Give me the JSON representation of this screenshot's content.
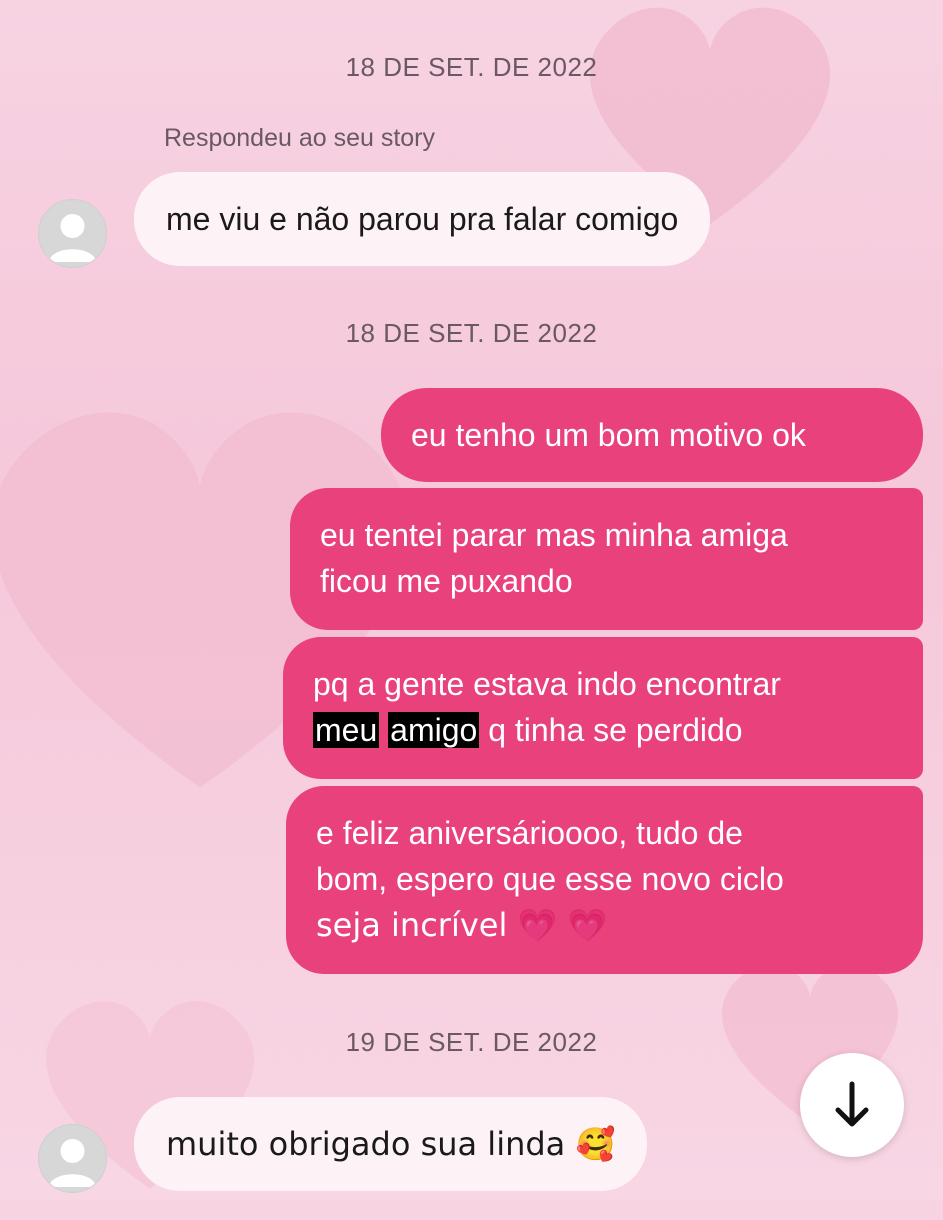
{
  "conversation": {
    "dates": [
      "18 DE SET. DE 2022",
      "18 DE SET. DE 2022",
      "19 DE SET. DE 2022"
    ],
    "story_reply_label": "Respondeu ao seu story",
    "incoming": [
      "me viu e não parou pra falar comigo",
      "muito obrigado sua linda 🥰"
    ],
    "outgoing": [
      {
        "text": "eu tenho um bom motivo ok"
      },
      {
        "lines": [
          "eu tentei parar mas minha amiga",
          "ficou me puxando"
        ]
      },
      {
        "line1": "pq a gente estava indo encontrar",
        "redacted_1": "meu",
        "redacted_2": "amigo",
        "line2_rest": "q tinha se perdido"
      },
      {
        "lines": [
          "e feliz aniversárioooo, tudo de",
          "bom, espero que esse novo ciclo",
          "seja incrível 💗 💗"
        ]
      }
    ]
  },
  "scroll_button": {
    "icon": "arrow-down-icon"
  },
  "colors": {
    "background": "#f6cfdf",
    "outgoing_bubble": "#e8417c",
    "incoming_bubble": "#fdf3f6",
    "date_text": "#6a5863"
  }
}
